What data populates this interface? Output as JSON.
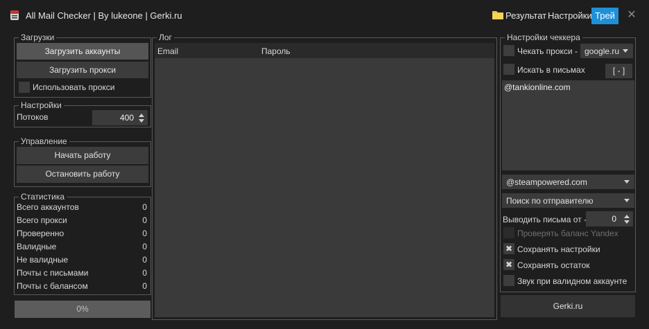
{
  "window": {
    "title": "All Mail Checker |  By lukeone | Gerki.ru",
    "result_link": "Результат",
    "settings_link": "Настройки",
    "tray_button": "Трей",
    "close_glyph": "✕"
  },
  "uploads": {
    "legend": "Загрузки",
    "load_accounts": "Загрузить аккаунты",
    "load_proxy": "Загрузить прокси",
    "use_proxy": "Использовать прокси",
    "use_proxy_checked": false
  },
  "settings": {
    "legend": "Настройки",
    "threads_label": "Потоков",
    "threads_value": "400"
  },
  "control": {
    "legend": "Управление",
    "start": "Начать работу",
    "stop": "Остановить работу"
  },
  "stats": {
    "legend": "Статистика",
    "rows": [
      {
        "label": "Всего аккаунтов",
        "value": "0"
      },
      {
        "label": "Всего прокси",
        "value": "0"
      },
      {
        "label": "Проверенно",
        "value": "0"
      },
      {
        "label": "Валидные",
        "value": "0"
      },
      {
        "label": "Не валидные",
        "value": "0"
      },
      {
        "label": "Почты с письмами",
        "value": "0"
      },
      {
        "label": "Почты с балансом",
        "value": "0"
      }
    ]
  },
  "progress": {
    "label": "0%",
    "percent": 0
  },
  "log": {
    "legend": "Лог",
    "columns": [
      "Email",
      "Пароль"
    ]
  },
  "checker": {
    "legend": "Настройки чеккера",
    "check_proxy_label": "Чекать прокси -",
    "check_proxy_checked": false,
    "proxy_site": "google.ru",
    "search_in_mail_label": "Искать в письмах",
    "search_in_mail_checked": false,
    "bracket_button": "[ - ]",
    "search_text": "@tankionline.com",
    "domain_select": "@steampowered.com",
    "search_mode_select": "Поиск по отправителю",
    "output_from_label": "Выводить письма от -",
    "output_from_value": "0",
    "yandex_label": "Проверять баланс Yandex",
    "save_settings_label": "Сохранять настройки",
    "save_rest_label": "Сохранять остаток",
    "sound_label": "Звук при валидном аккаунте",
    "footer_button": "Gerki.ru"
  }
}
